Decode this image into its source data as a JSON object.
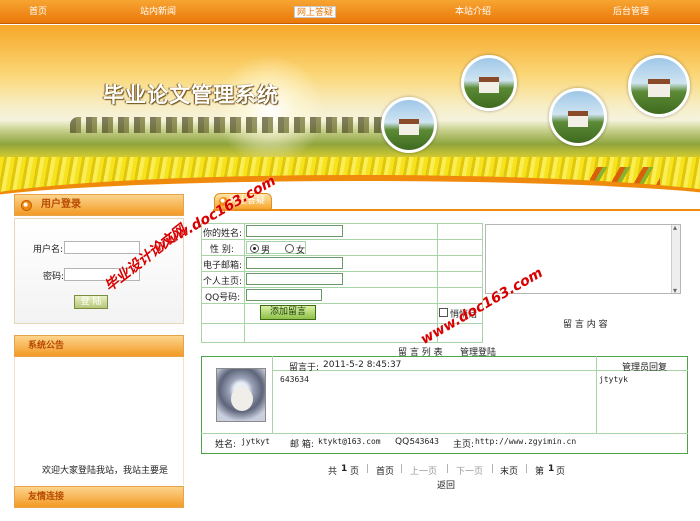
{
  "nav": {
    "items": [
      {
        "label": "首页"
      },
      {
        "label": "站内新闻"
      },
      {
        "label": "网上答疑"
      },
      {
        "label": "本站介绍"
      },
      {
        "label": "后台管理"
      }
    ]
  },
  "banner": {
    "title": "毕业论文管理系统"
  },
  "sidebar": {
    "login": {
      "header": "用户登录",
      "username_label": "用户名:",
      "password_label": "密码:",
      "button": "登 陆"
    },
    "notice": {
      "header": "系统公告",
      "text": "欢迎大家登陆我站，我站主要是"
    },
    "links": {
      "header": "友情连接"
    }
  },
  "main": {
    "tab_label": "网上答疑",
    "form": {
      "name_label": "你的姓名:",
      "gender_label": "性  别:",
      "gender_male": "男",
      "gender_female": "女",
      "email_label": "电子邮箱:",
      "homepage_label": "个人主页:",
      "qq_label": "QQ号码:",
      "submit_button": "添加留言",
      "private_label": "悄悄话",
      "content_label": "留 言 内 容"
    },
    "list": {
      "toolbar_left": "留  言  列  表",
      "toolbar_right": "管理登陆",
      "message": {
        "posted_label": "留言于:",
        "posted_time": "2011-5-2 8:45:37",
        "admin_reply_label": "管理员回复",
        "body": "643634",
        "reply": "jtytyk",
        "name_label": "姓名:",
        "name": "jytkyt",
        "email_label": "邮 箱:",
        "email": "ktykt@163.com",
        "qq_label": "QQ:",
        "qq": "543643",
        "homepage_label": "主页:",
        "homepage": "http://www.zgyimin.cn"
      }
    },
    "pager": {
      "total_prefix": "共",
      "total": "1",
      "total_suffix": "页",
      "first": "首页",
      "prev": "上一页",
      "next": "下一页",
      "last": "末页",
      "current_prefix": "第",
      "current": "1",
      "current_suffix": "页",
      "back": "返回"
    }
  },
  "watermarks": {
    "site_cn": "毕业设计论文网",
    "site_url": "www.doc163.com",
    "site_url2": "www.doc163.com"
  },
  "colors": {
    "nav_orange": "#e9780a",
    "header_text": "#b94a00",
    "grid_green": "#a8d4a8",
    "watermark_red": "#d80000"
  }
}
